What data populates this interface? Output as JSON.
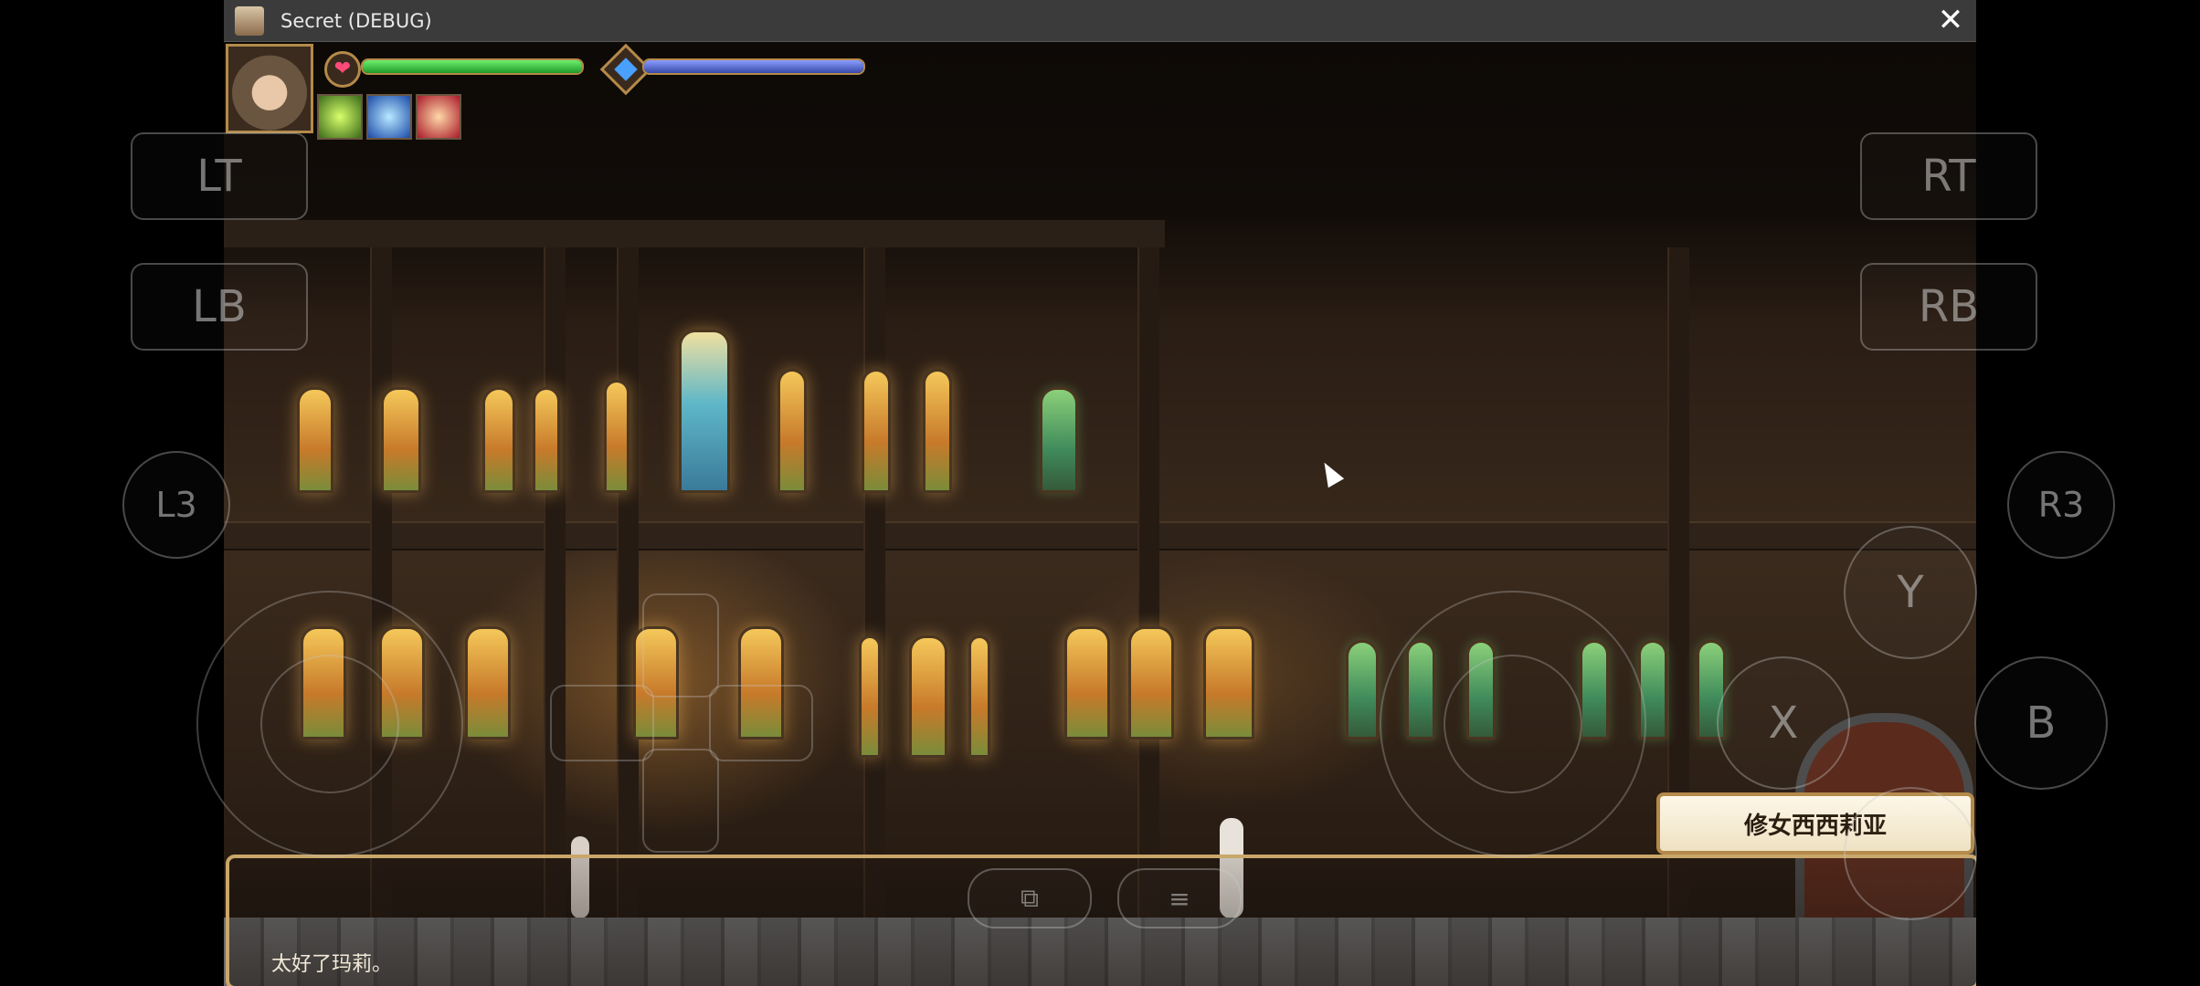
{
  "window": {
    "title": "Secret (DEBUG)",
    "close_glyph": "✕"
  },
  "hud": {
    "hp_fraction": 1.0,
    "mp_fraction": 1.0,
    "heart_glyph": "❤"
  },
  "dialog": {
    "speaker": "修女西西莉亚",
    "text": "太好了玛莉。"
  },
  "gamepad": {
    "lt": "LT",
    "lb": "LB",
    "rt": "RT",
    "rb": "RB",
    "l3": "L3",
    "r3": "R3",
    "y": "Y",
    "x": "X",
    "b": "B"
  },
  "colors": {
    "hp": "#1f9a2a",
    "mp": "#3a4aa8",
    "frame": "#b48a4a"
  }
}
